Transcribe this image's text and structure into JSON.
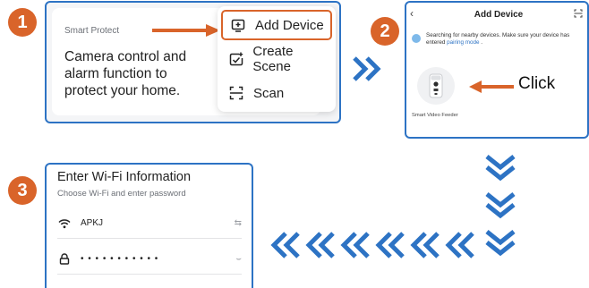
{
  "colors": {
    "accent": "#d9642a",
    "frame": "#2d73c4",
    "link": "#2d73c4"
  },
  "badges": [
    "1",
    "2",
    "3"
  ],
  "step1": {
    "section_title": "Smart Protect",
    "description_lines": [
      "Camera control and",
      "alarm function to",
      "protect your home."
    ],
    "menu": [
      {
        "icon": "add-device-icon",
        "label": "Add Device",
        "highlighted": true
      },
      {
        "icon": "create-scene-icon",
        "label": "Create Scene",
        "highlighted": false
      },
      {
        "icon": "scan-icon",
        "label": "Scan",
        "highlighted": false
      }
    ]
  },
  "step2": {
    "header_title": "Add Device",
    "search_text": "Searching for nearby devices. Make sure your device has entered",
    "pairing_link": "pairing mode",
    "search_suffix": ".",
    "device_name": "Smart Video Feeder",
    "click_label": "Click"
  },
  "step3": {
    "title": "Enter Wi-Fi Information",
    "subtitle": "Choose Wi-Fi and enter password",
    "wifi_name": "APKJ",
    "password_mask": "• • • • • • • • • • •"
  }
}
